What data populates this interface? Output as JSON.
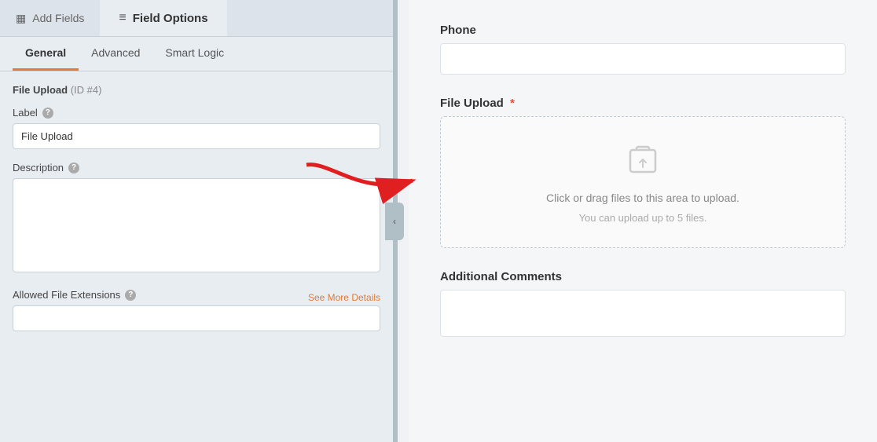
{
  "header": {
    "add_fields_label": "Add Fields",
    "field_options_label": "Field Options",
    "add_fields_icon": "☰",
    "field_options_icon": "⚙"
  },
  "sub_tabs": {
    "general_label": "General",
    "advanced_label": "Advanced",
    "smart_logic_label": "Smart Logic"
  },
  "field_settings": {
    "title": "File Upload",
    "id_label": "(ID #4)",
    "label_field_label": "Label",
    "label_field_help": "?",
    "label_field_value": "File Upload",
    "description_label": "Description",
    "description_help": "?",
    "description_placeholder": "",
    "allowed_extensions_label": "Allowed File Extensions",
    "allowed_extensions_help": "?",
    "see_more_label": "See More Details",
    "allowed_extensions_value": ""
  },
  "right_panel": {
    "phone_label": "Phone",
    "file_upload_label": "File Upload",
    "required_star": "*",
    "upload_text": "Click or drag files to this area to upload.",
    "upload_subtext": "You can upload up to 5 files.",
    "additional_comments_label": "Additional Comments"
  },
  "collapse_icon": "‹"
}
